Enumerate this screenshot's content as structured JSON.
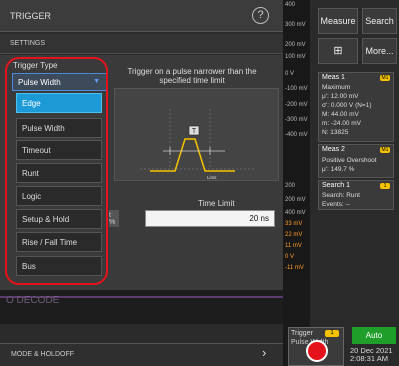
{
  "panel": {
    "title": "TRIGGER",
    "help_icon": "?",
    "section": "SETTINGS",
    "trigger_type_label": "Trigger Type",
    "trigger_type_value": "Pulse Width",
    "options": [
      "Edge",
      "Pulse Width",
      "Timeout",
      "Runt",
      "Logic",
      "Setup & Hold",
      "Rise / Fall Time",
      "Bus"
    ],
    "selected_option": "Edge",
    "description": "Trigger on a pulse narrower than the specified time limit",
    "diagram_label": "Limit",
    "diagram_marker": "T",
    "time_limit_label": "Time Limit",
    "time_limit_value": "20 ns",
    "partial_cut": "t %",
    "decode_text": "O DECODE",
    "mode_holdoff": "MODE & HOLDOFF",
    "arrow": "›"
  },
  "scale": {
    "values": [
      "400",
      "300 mV",
      "200 mV",
      "100 mV",
      "0 V",
      "-100 mV",
      "-200 mV",
      "-300 mV",
      "-400 mV"
    ],
    "values2": [
      "200",
      "200 mV",
      "400 mV",
      "33 mV",
      "22 mV",
      "11 mV",
      "0 V",
      "-11 mV"
    ]
  },
  "right": {
    "measure_label": "Measure",
    "search_label": "Search",
    "more_label": "More...",
    "meas1": {
      "title": "Meas 1",
      "badge": "M1",
      "rows": [
        "Maximum",
        "μ': 12.00 mV",
        "σ': 0.000 V (N=1)",
        "M: 44.00 mV",
        "m: -24.00 mV",
        "N: 13825"
      ]
    },
    "meas2": {
      "title": "Meas 2",
      "badge": "M1",
      "rows": [
        "Positive Overshoot",
        "μ': 149.7 %"
      ]
    },
    "search1": {
      "title": "Search 1",
      "badge": "1",
      "rows": [
        "Search: Runt",
        "Events: --"
      ]
    },
    "trigger": {
      "title": "Trigger",
      "badge": "1",
      "sub": "Pulse Width"
    },
    "acq_mode": "Auto",
    "date": "20 Dec 2021",
    "time": "2:08:31 AM"
  },
  "colors": {
    "accent": "#1c9ad6",
    "highlight": "#e4131b",
    "yellow": "#f4c400",
    "green": "#1f9e2a"
  }
}
